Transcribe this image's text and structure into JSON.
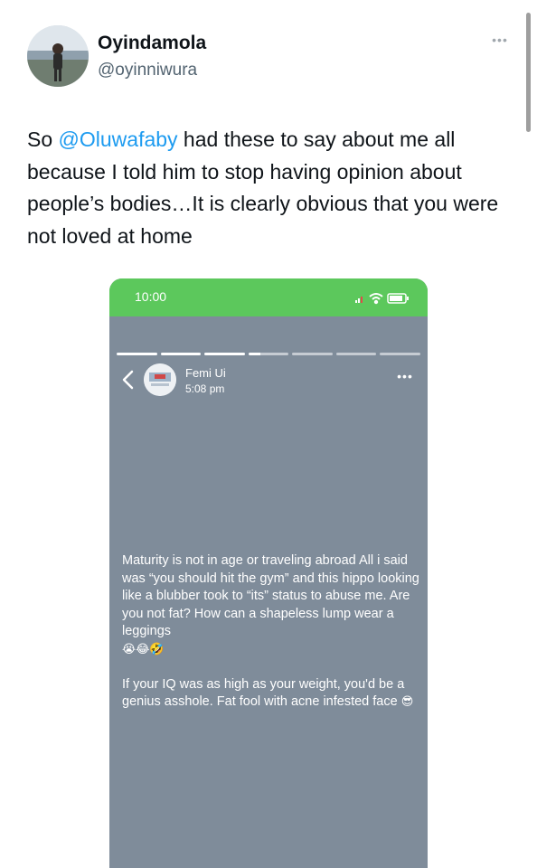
{
  "tweet": {
    "display_name": "Oyindamola",
    "handle": "@oyinniwura",
    "more_label": "•••",
    "text_before": "So ",
    "mention": "@Oluwafaby",
    "text_after": " had these to say about me all because I told him to stop having opinion about people’s bodies…It is clearly obvious that you were not loved at home",
    "avatar_icon": "profile-photo",
    "mention_color": "#1d9bf0"
  },
  "screenshot": {
    "status_bar": {
      "time": "10:00",
      "icons": [
        "signal-icon",
        "wifi-icon",
        "battery-icon"
      ],
      "color": "#5cc85c"
    },
    "story": {
      "progress_segments": [
        1,
        1,
        1,
        0.3,
        0,
        0,
        0
      ],
      "author": "Femi Ui",
      "time": "5:08 pm",
      "more_label": "•••",
      "paragraph1": "Maturity is not in age or traveling abroad All i said was “you should hit the gym” and this hippo looking like a blubber took to “its” status to abuse me. Are you not fat? How can a shapeless lump wear a leggings",
      "paragraph1_emoji": "😭😂🤣",
      "paragraph2": "If your IQ was as high as your weight, you'd be a genius asshole. Fat fool with acne infested face",
      "paragraph2_emoji": "😎",
      "background": "#7f8c9a"
    }
  }
}
